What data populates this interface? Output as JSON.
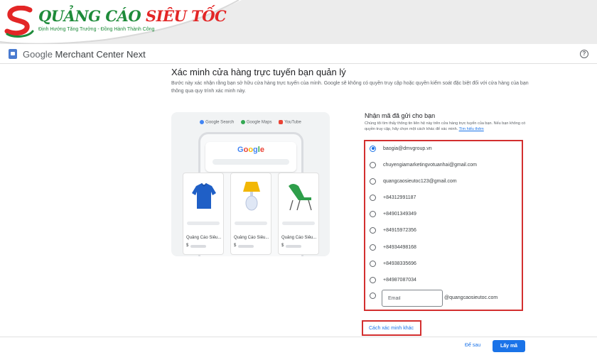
{
  "brand": {
    "title_green": "QUẢNG CÁO",
    "title_red": "SIÊU TỐC",
    "tagline": "Định Hướng Tăng Trưởng - Đồng Hành Thành Công"
  },
  "app": {
    "title_google": "Google",
    "title_rest": " Merchant Center Next",
    "help_icon": "?"
  },
  "page": {
    "title": "Xác minh cửa hàng trực tuyến bạn quản lý",
    "description": "Bước này xác nhận rằng bạn sở hữu cửa hàng trực tuyến của mình. Google sẽ không có quyền truy cập hoặc quyền kiểm soát đặc biệt đối với cửa hàng của bạn thông qua quy trình xác minh này."
  },
  "illustration": {
    "chips": [
      "Google Search",
      "Google Maps",
      "YouTube"
    ],
    "google_word": "Google",
    "products": [
      {
        "name": "Quảng Cáo Siêu...",
        "price_symbol": "$"
      },
      {
        "name": "Quảng Cáo Siêu...",
        "price_symbol": "$"
      },
      {
        "name": "Quảng Cáo Siêu...",
        "price_symbol": "$"
      }
    ]
  },
  "verify": {
    "title": "Nhận mã đã gửi cho bạn",
    "description": "Chúng tôi tìm thấy thông tin liên hệ này trên cửa hàng trực tuyến của bạn. Nếu bạn không có quyền truy cập, hãy chọn một cách khác để xác minh.",
    "learn_more": "Tìm hiểu thêm",
    "options": [
      "baogia@dmvgroup.vn",
      "chuyengiamarketingvotuanhai@gmail.com",
      "quangcaosieutoc123@gmail.com",
      "+84312991187",
      "+84901349349",
      "+84915972356",
      "+84934498168",
      "+84938335696",
      "+84987087034"
    ],
    "selected_index": 0,
    "email_placeholder": "Email",
    "email_suffix": "@quangcaosieutoc.com",
    "other_method": "Cách xác minh khác"
  },
  "footer": {
    "later": "Để sau",
    "get_code": "Lấy mã"
  },
  "colors": {
    "accent": "#1a73e8",
    "highlight": "#d32f2f",
    "brand_green": "#1e8b3a",
    "brand_red": "#e32626"
  }
}
